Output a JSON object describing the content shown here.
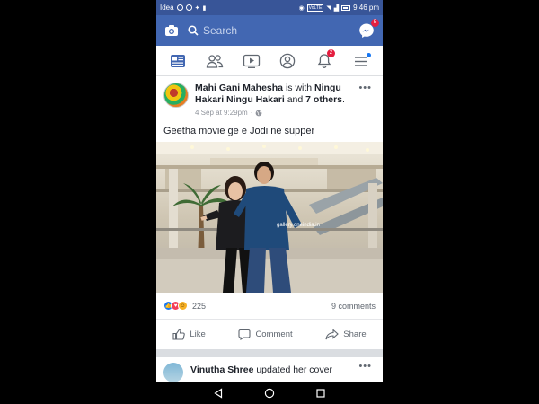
{
  "status_bar": {
    "carrier": "Idea",
    "network_label": "VoLTE",
    "time": "9:46 pm"
  },
  "top_bar": {
    "search_placeholder": "Search",
    "messenger_badge": "5",
    "bg_color": "#4267b2"
  },
  "nav_tabs": {
    "items": [
      {
        "name": "news-feed",
        "icon": "news-feed-icon",
        "active": true
      },
      {
        "name": "friends",
        "icon": "friends-icon"
      },
      {
        "name": "watch",
        "icon": "video-play-icon"
      },
      {
        "name": "profile",
        "icon": "profile-icon"
      },
      {
        "name": "notifications",
        "icon": "bell-icon",
        "badge": "2"
      },
      {
        "name": "menu",
        "icon": "hamburger-menu-icon"
      }
    ]
  },
  "post": {
    "author": "Mahi Gani Mahesha",
    "with_text": " is with ",
    "tagged": "Ningu Hakari Ningu Hakari",
    "and_text": " and ",
    "others": "7 others",
    "period": ".",
    "timestamp": "4 Sep at 9:29pm",
    "privacy_icon": "globe-icon",
    "text": "Geetha movie ge e Jodi ne supper",
    "photo_watermark": "gallery.oneindia.in",
    "reaction_count": "225",
    "comments_count": "9 comments",
    "actions": {
      "like": "Like",
      "comment": "Comment",
      "share": "Share"
    }
  },
  "post2": {
    "author": "Vinutha Shree",
    "action_text": " updated her cover"
  }
}
